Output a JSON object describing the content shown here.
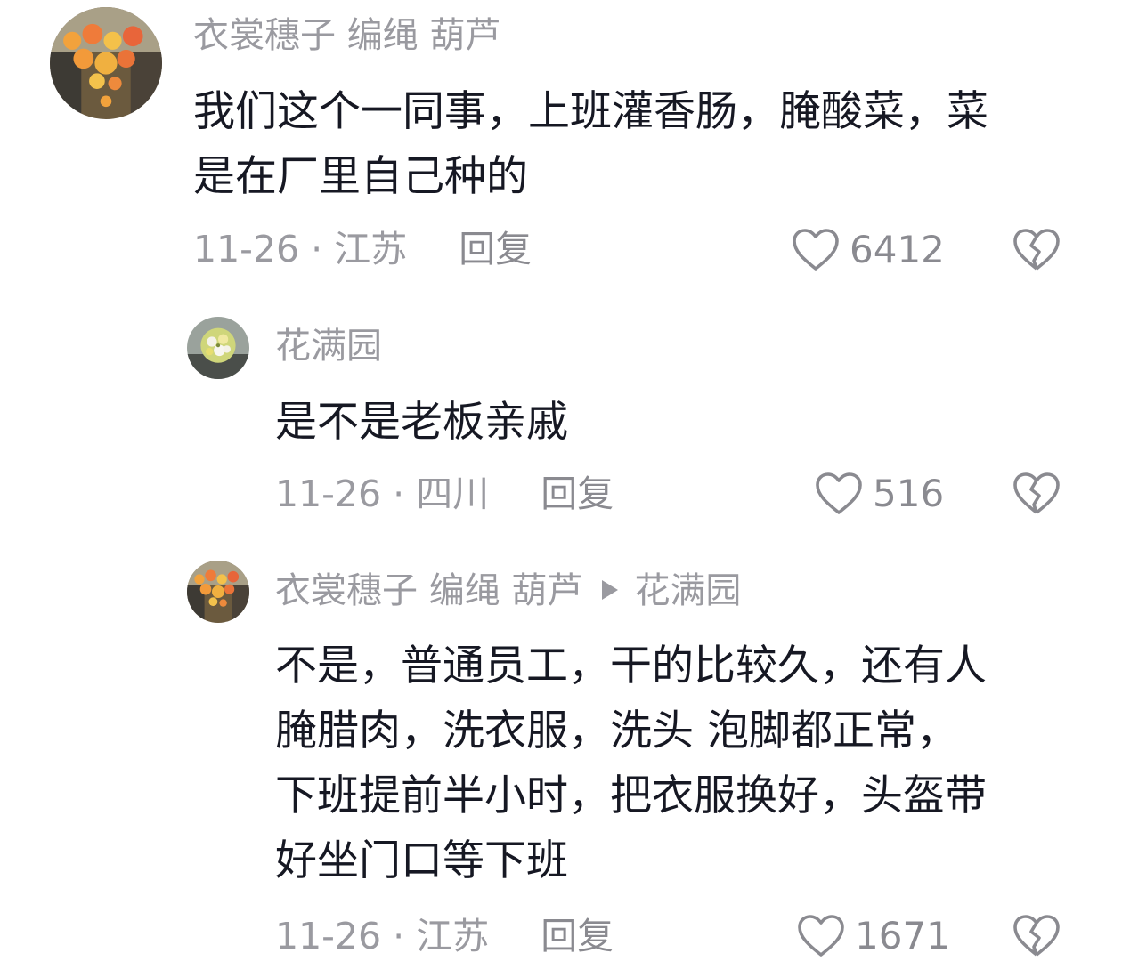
{
  "comments": [
    {
      "username": "衣裳穗子 编绳 葫芦",
      "text": "我们这个一同事，上班灌香肠，腌酸菜，菜\n是在厂里自己种的",
      "date": "11-26",
      "location": "江苏",
      "reply_label": "回复",
      "like_count": "6412",
      "avatar_icon": "lantern-street-avatar-icon"
    },
    {
      "username": "花满园",
      "text": "是不是老板亲戚",
      "date": "11-26",
      "location": "四川",
      "reply_label": "回复",
      "like_count": "516",
      "avatar_icon": "flower-bouquet-avatar-icon"
    },
    {
      "username": "衣裳穗子 编绳 葫芦",
      "reply_to": "花满园",
      "text": "不是，普通员工，干的比较久，还有人\n腌腊肉，洗衣服，洗头 泡脚都正常，\n下班提前半小时，把衣服换好，头盔带\n好坐门口等下班",
      "date": "11-26",
      "location": "江苏",
      "reply_label": "回复",
      "like_count": "1671",
      "avatar_icon": "lantern-street-avatar-icon"
    }
  ],
  "separator": " · ",
  "colors": {
    "text": "#161823",
    "muted": "#9a9aa0",
    "background": "#ffffff"
  }
}
